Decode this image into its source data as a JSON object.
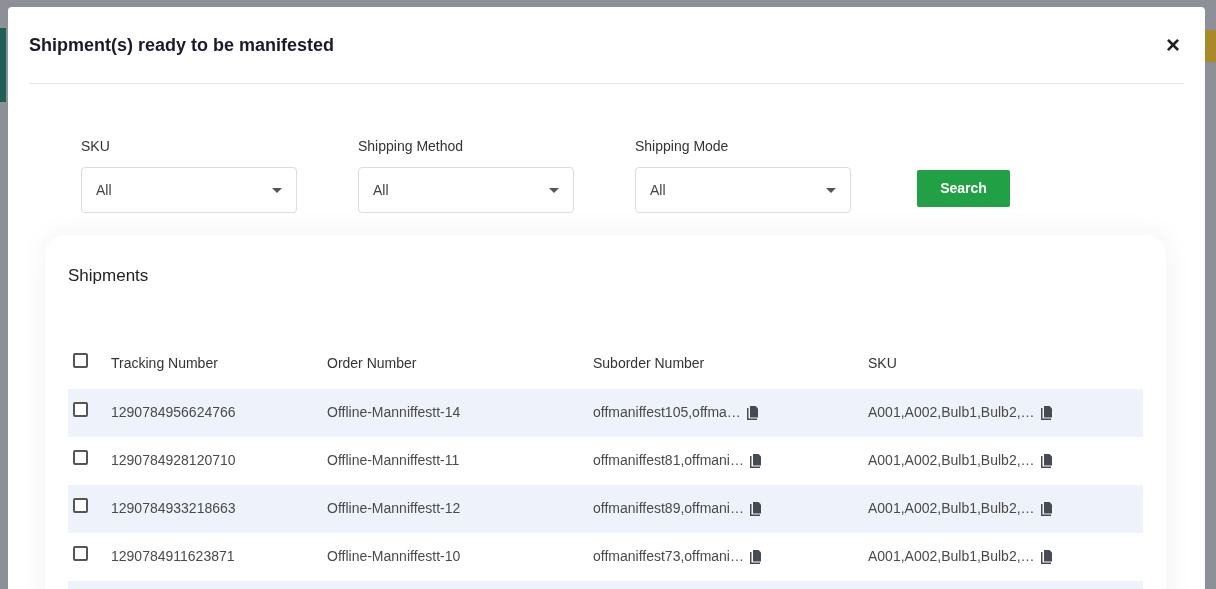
{
  "modal": {
    "title": "Shipment(s) ready to be manifested",
    "close": "×"
  },
  "filters": [
    {
      "label": "SKU",
      "value": "All"
    },
    {
      "label": "Shipping Method",
      "value": "All"
    },
    {
      "label": "Shipping Mode",
      "value": "All"
    }
  ],
  "search_button": "Search",
  "shipments": {
    "title": "Shipments",
    "select_all_checked": false,
    "columns": [
      "Tracking Number",
      "Order Number",
      "Suborder Number",
      "SKU"
    ],
    "rows": [
      {
        "tracking": "1290784956624766",
        "order": "Offline-Manniffestt-14",
        "suborder": "offmaniffest105,offma…",
        "sku": "A001,A002,Bulb1,Bulb2,…",
        "checked": false
      },
      {
        "tracking": "1290784928120710",
        "order": "Offline-Manniffestt-11",
        "suborder": "offmaniffest81,offmani…",
        "sku": "A001,A002,Bulb1,Bulb2,…",
        "checked": false
      },
      {
        "tracking": "1290784933218663",
        "order": "Offline-Manniffestt-12",
        "suborder": "offmaniffest89,offmani…",
        "sku": "A001,A002,Bulb1,Bulb2,…",
        "checked": false
      },
      {
        "tracking": "1290784911623871",
        "order": "Offline-Manniffestt-10",
        "suborder": "offmaniffest73,offmani…",
        "sku": "A001,A002,Bulb1,Bulb2,…",
        "checked": false
      }
    ]
  }
}
